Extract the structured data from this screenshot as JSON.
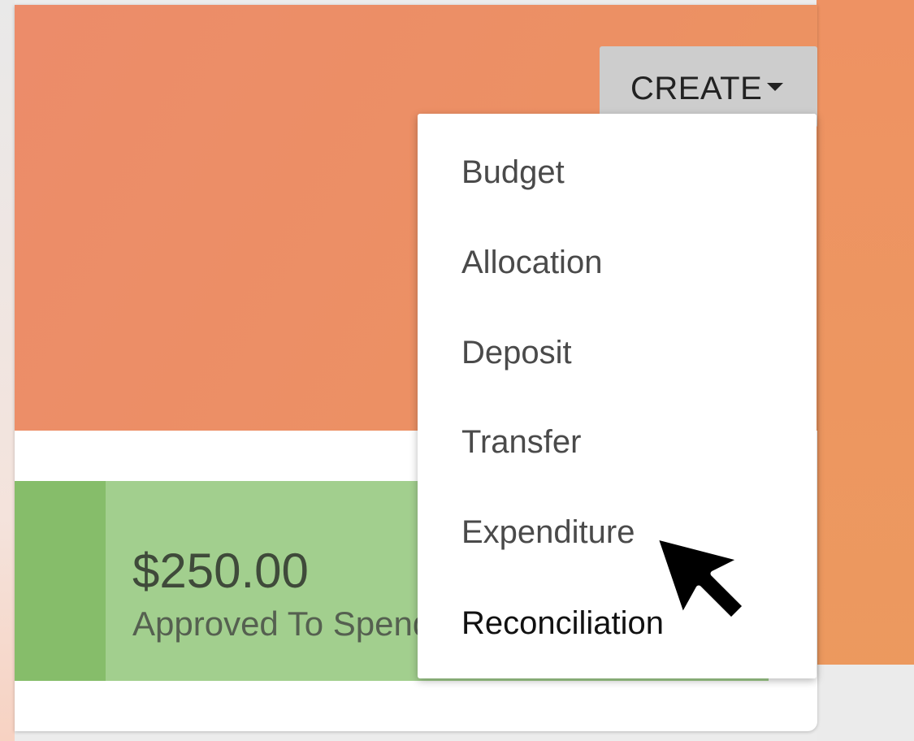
{
  "header": {
    "create_label": "CREATE",
    "create_icon": "caret-down-icon"
  },
  "summary": {
    "amount": "$250.00",
    "label": "Approved To Spend"
  },
  "create_menu": {
    "items": [
      {
        "label": "Budget",
        "state": "default"
      },
      {
        "label": "Allocation",
        "state": "default"
      },
      {
        "label": "Deposit",
        "state": "default"
      },
      {
        "label": "Transfer",
        "state": "default"
      },
      {
        "label": "Expenditure",
        "state": "default"
      },
      {
        "label": "Reconciliation",
        "state": "active"
      }
    ]
  },
  "colors": {
    "hero": "#ec8c6a",
    "summary_bg": "#a2cf8e",
    "summary_bar": "#86bd6a",
    "create_button": "#cdcdcd"
  }
}
